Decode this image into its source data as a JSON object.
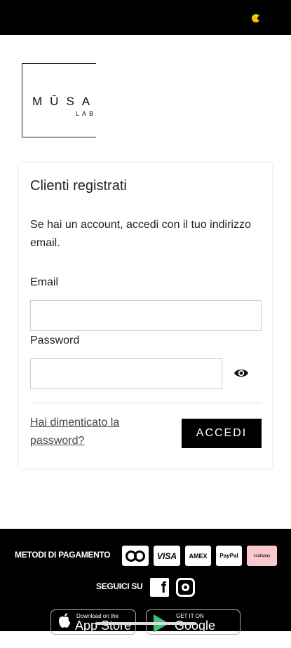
{
  "logo": {
    "word": "MŪSA",
    "sub": "LAB"
  },
  "login": {
    "title": "Clienti registrati",
    "description": "Se hai un account, accedi con il tuo indirizzo email.",
    "email_label": "Email",
    "email_value": "",
    "password_label": "Password",
    "password_value": "",
    "forgot_link": "Hai dimenticato la password?",
    "submit_label": "ACCEDI"
  },
  "footer": {
    "payment_label": "METODI DI PAGAMENTO",
    "payment_methods": [
      "Mastercard",
      "VISA",
      "AMEX",
      "PayPal",
      "scalapay"
    ],
    "follow_label": "SEGUICI SU",
    "social": [
      "facebook-icon",
      "instagram-icon"
    ],
    "appstore_small": "Download on the",
    "appstore_big": "App Store",
    "gplay_small": "GET IT ON",
    "gplay_big": "Google Play"
  },
  "colors": {
    "accent": "#000000",
    "status_icon": "#f5c400",
    "scalapay_bg": "#f9c9cf",
    "play_green": "#3ec17b"
  }
}
